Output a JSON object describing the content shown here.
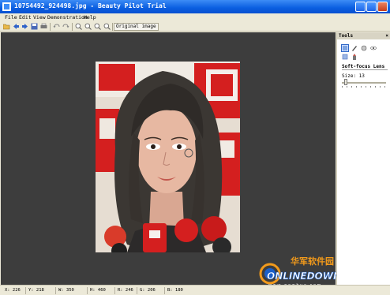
{
  "window": {
    "title": "10754492_924498.jpg - Beauty Pilot Trial"
  },
  "menu": [
    "File",
    "Edit",
    "View",
    "Demonstration",
    "Help"
  ],
  "toolbar": {
    "icons": [
      "open-icon",
      "back-icon",
      "forward-icon",
      "save-icon",
      "print-icon",
      "undo-icon",
      "redo-icon",
      "zoom-in-icon",
      "zoom-out-icon",
      "zoom-fit-icon",
      "zoom-actual-icon"
    ],
    "original_label": "Original image"
  },
  "tools": {
    "header": "Tools",
    "close": "×",
    "lens_label": "Soft-focus Lens",
    "size_label": "Size: 13",
    "size_value": 13
  },
  "status": {
    "x": "X: 226",
    "y": "Y: 218",
    "w": "W: 350",
    "h": "H: 460",
    "r": "R: 246",
    "g": "G: 206",
    "b": "B: 180"
  },
  "watermark": {
    "chinese": "华军软件园",
    "brand": "ONLINEDOWN",
    "url": "w w w . n e w h u a . c o m"
  },
  "colors": {
    "titlebar": "#0a5ee0",
    "canvas": "#3d3d3d",
    "accent_red": "#d41f1f",
    "watermark_blue": "#1a5fc9",
    "watermark_orange": "#f29a1b"
  }
}
